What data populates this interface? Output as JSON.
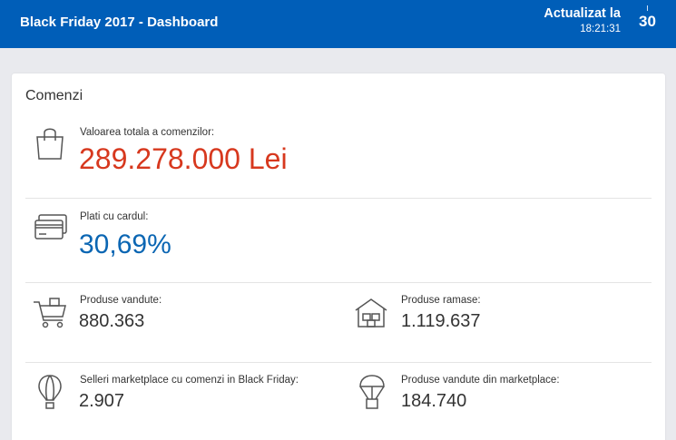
{
  "header": {
    "title": "Black Friday 2017 - Dashboard",
    "updated_label": "Actualizat la",
    "updated_time": "18:21:31",
    "countdown": "30"
  },
  "card": {
    "title": "Comenzi",
    "total": {
      "label": "Valoarea totala a comenzilor:",
      "value": "289.278.000 Lei",
      "icon": "shopping-bag-icon"
    },
    "card_payments": {
      "label": "Plati cu cardul:",
      "value": "30,69%",
      "icon": "credit-card-icon"
    },
    "sold": {
      "label": "Produse vandute:",
      "value": "880.363",
      "icon": "shopping-cart-icon"
    },
    "remaining": {
      "label": "Produse ramase:",
      "value": "1.119.637",
      "icon": "warehouse-icon"
    },
    "sellers": {
      "label": "Selleri marketplace cu comenzi in Black Friday:",
      "value": "2.907",
      "icon": "hot-air-balloon-icon"
    },
    "marketplace_sold": {
      "label": "Produse vandute din marketplace:",
      "value": "184.740",
      "icon": "parachute-box-icon"
    }
  },
  "colors": {
    "header_bg": "#005eb8",
    "accent_red": "#d7381e",
    "accent_blue": "#0b66b3"
  }
}
